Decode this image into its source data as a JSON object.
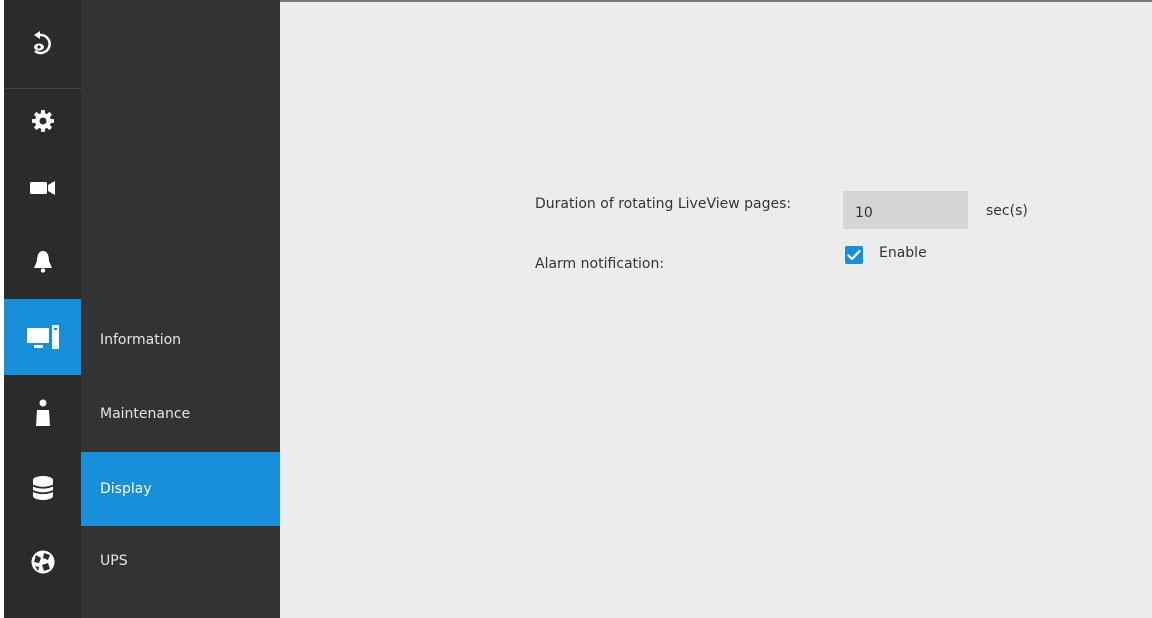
{
  "colors": {
    "accent": "#1a8fd9",
    "rail_bg": "#2b2b2b",
    "subnav_bg": "#333333",
    "content_bg": "#ececec",
    "field_bg": "#d5d5d5"
  },
  "rail": {
    "items": [
      {
        "icon": "back-icon",
        "active": false
      },
      {
        "icon": "gear-icon",
        "active": false
      },
      {
        "icon": "camera-icon",
        "active": false
      },
      {
        "icon": "bell-icon",
        "active": false
      },
      {
        "icon": "monitor-icon",
        "active": true
      },
      {
        "icon": "user-icon",
        "active": false
      },
      {
        "icon": "database-icon",
        "active": false
      },
      {
        "icon": "globe-icon",
        "active": false
      }
    ]
  },
  "subnav": {
    "items": [
      {
        "label": "Information",
        "active": false
      },
      {
        "label": "Maintenance",
        "active": false
      },
      {
        "label": "Display",
        "active": true
      },
      {
        "label": "UPS",
        "active": false
      }
    ]
  },
  "form": {
    "duration_label": "Duration of rotating LiveView pages:",
    "duration_value": "10",
    "duration_unit": "sec(s)",
    "alarm_label": "Alarm notification:",
    "alarm_enable_label": "Enable",
    "alarm_enabled": true
  }
}
